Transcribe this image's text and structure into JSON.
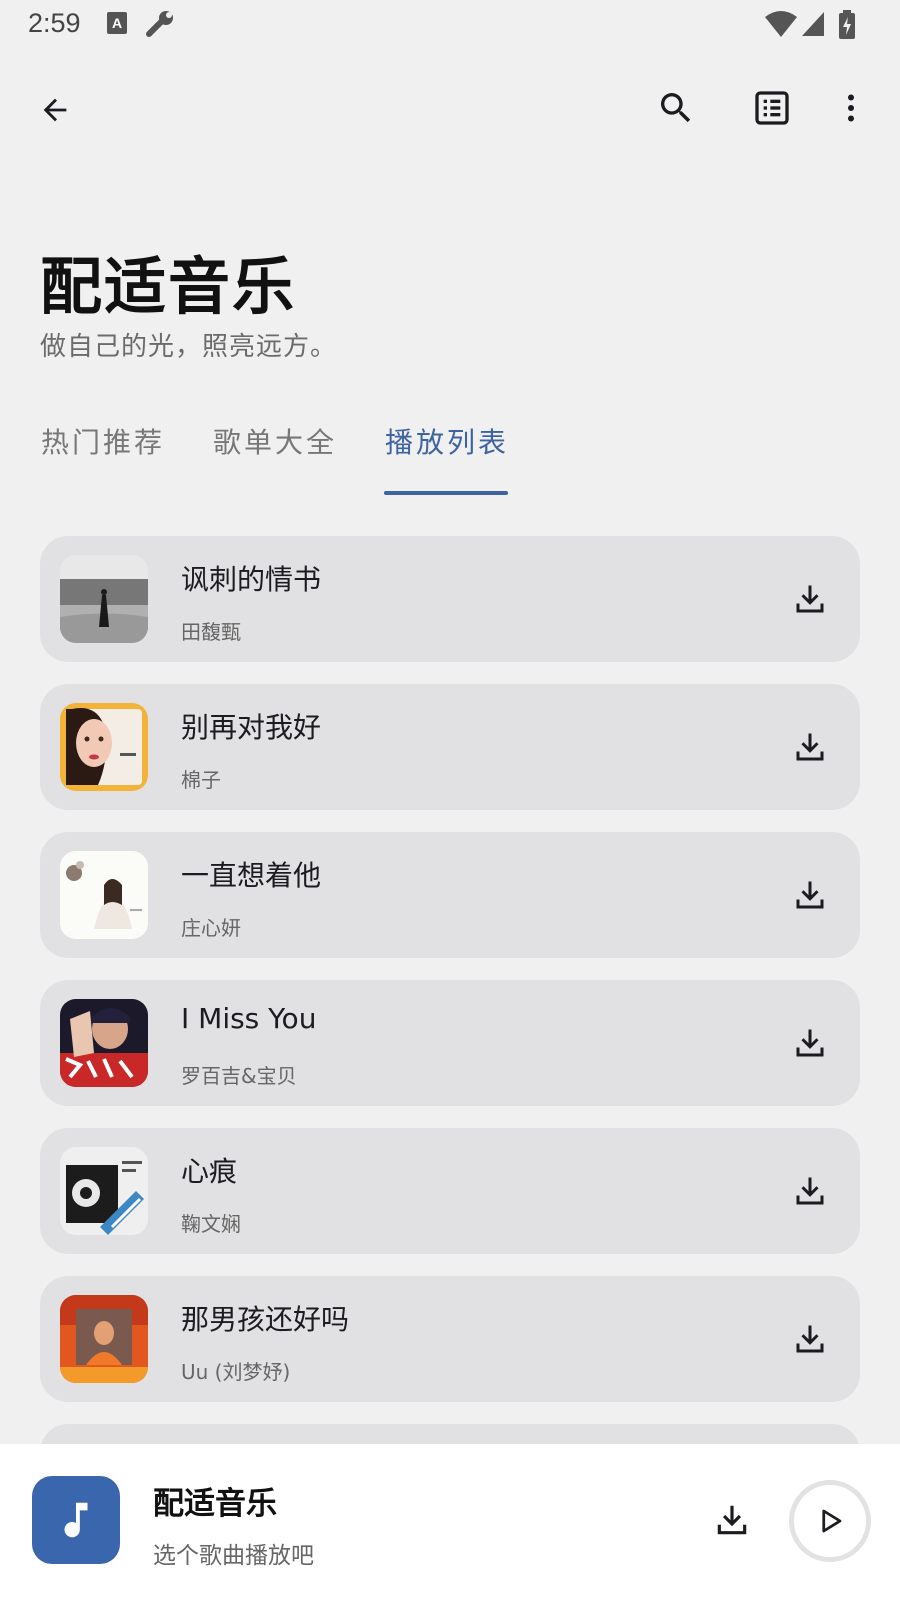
{
  "status": {
    "time": "2:59",
    "icons": [
      "a-keyboard-icon",
      "wrench-icon",
      "wifi-icon",
      "signal-icon",
      "battery-charging-icon"
    ]
  },
  "topbar": {
    "icons": [
      "back-arrow-icon",
      "search-icon",
      "list-view-icon",
      "more-vert-icon"
    ]
  },
  "header": {
    "title": "配适音乐",
    "subtitle": "做自己的光，照亮远方。"
  },
  "tabs": [
    {
      "label": "热门推荐",
      "active": false
    },
    {
      "label": "歌单大全",
      "active": false
    },
    {
      "label": "播放列表",
      "active": true
    }
  ],
  "colors": {
    "accent": "#3e63a3",
    "card": "#e1e1e3",
    "background": "#f0f0f0"
  },
  "songs": [
    {
      "title": "讽刺的情书",
      "artist": "田馥甄",
      "cover": "grayscale-field-cover"
    },
    {
      "title": "别再对我好",
      "artist": "棉子",
      "cover": "orange-portrait-cover"
    },
    {
      "title": "一直想着他",
      "artist": "庄心妍",
      "cover": "white-dress-cover"
    },
    {
      "title": "I Miss You",
      "artist": "罗百吉&宝贝",
      "cover": "red-black-poster-cover"
    },
    {
      "title": "心痕",
      "artist": "鞠文娴",
      "cover": "monochrome-blue-cover"
    },
    {
      "title": "那男孩还好吗",
      "artist": "Uu (刘梦妤)",
      "cover": "orange-sunset-cover"
    }
  ],
  "player": {
    "title": "配适音乐",
    "subtitle": "选个歌曲播放吧",
    "icons": [
      "music-note-icon",
      "download-icon",
      "play-icon"
    ]
  }
}
